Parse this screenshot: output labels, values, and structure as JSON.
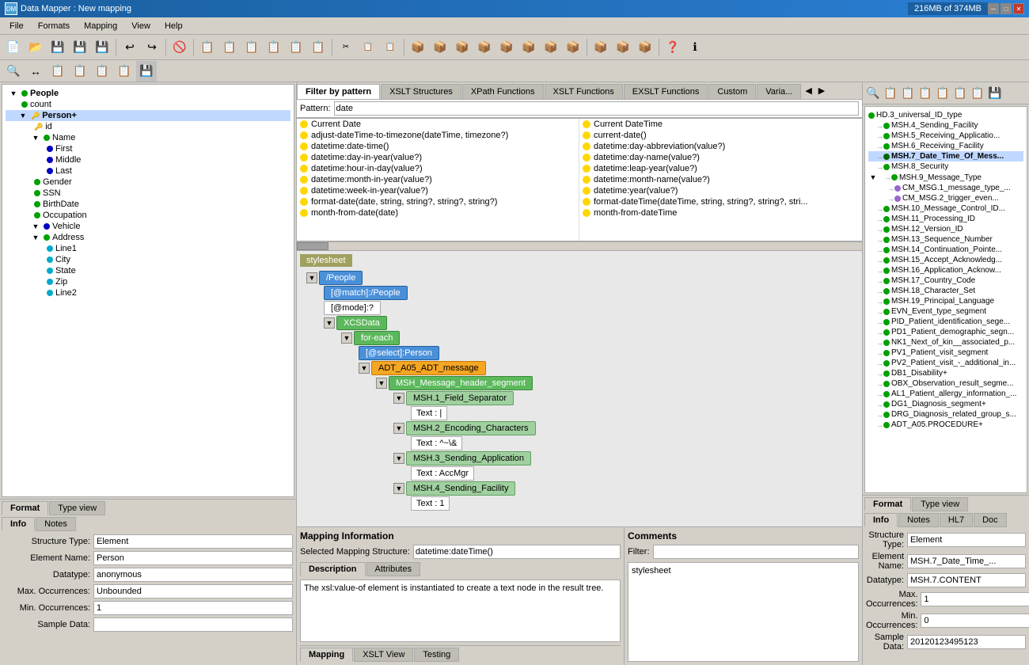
{
  "title_bar": {
    "icon": "DM",
    "title": "Data Mapper : New mapping",
    "memory": "216MB of 374MB"
  },
  "menu": {
    "items": [
      "File",
      "Formats",
      "Mapping",
      "View",
      "Help"
    ]
  },
  "filter_tabs": {
    "tabs": [
      "Filter by pattern",
      "XSLT Structures",
      "XPath Functions",
      "XSLT Functions",
      "EXSLT Functions",
      "Custom",
      "Varia..."
    ],
    "active": 0,
    "pattern_label": "Pattern:",
    "pattern_value": "date"
  },
  "functions": {
    "left": [
      "Current Date",
      "adjust-dateTime-to-timezone(dateTime, timezone?)",
      "datetime:date-time()",
      "datetime:day-in-year(value?)",
      "datetime:hour-in-day(value?)",
      "datetime:month-in-year(value?)",
      "datetime:week-in-year(value?)",
      "format-date(date, string, string?, string?, string?)",
      "month-from-date(date)"
    ],
    "right": [
      "Current DateTime",
      "current-date()",
      "datetime:day-abbreviation(value?)",
      "datetime:day-name(value?)",
      "datetime:leap-year(value?)",
      "datetime:month-name(value?)",
      "datetime:year(value?)",
      "format-dateTime(dateTime, string, string?, string?, stri...",
      "month-from-dateTime"
    ]
  },
  "mapping_tree": {
    "stylesheet_label": "stylesheet",
    "nodes": [
      {
        "indent": 0,
        "toggle": "▼",
        "label": "/People",
        "type": "blue"
      },
      {
        "indent": 1,
        "label": "[@match]:/People",
        "type": "blue"
      },
      {
        "indent": 1,
        "label": "[@mode]:?",
        "type": "white"
      },
      {
        "indent": 1,
        "toggle": "▼",
        "label": "XCSData",
        "type": "green"
      },
      {
        "indent": 2,
        "toggle": "▼",
        "label": "for-each",
        "type": "green"
      },
      {
        "indent": 3,
        "label": "[@select]:Person",
        "type": "blue"
      },
      {
        "indent": 3,
        "toggle": "▼",
        "label": "ADT_A05_ADT_message",
        "type": "orange"
      },
      {
        "indent": 4,
        "toggle": "▼",
        "label": "MSH_Message_header_segment",
        "type": "green"
      },
      {
        "indent": 5,
        "toggle": "▼",
        "label": "MSH.1_Field_Separator",
        "type": "light"
      },
      {
        "indent": 6,
        "label": "Text : |",
        "type": "text"
      },
      {
        "indent": 5,
        "toggle": "▼",
        "label": "MSH.2_Encoding_Characters",
        "type": "light"
      },
      {
        "indent": 6,
        "label": "Text : ^~\\&",
        "type": "text"
      },
      {
        "indent": 5,
        "toggle": "▼",
        "label": "MSH.3_Sending_Application",
        "type": "light"
      },
      {
        "indent": 6,
        "label": "Text : AccMgr",
        "type": "text"
      },
      {
        "indent": 5,
        "toggle": "▼",
        "label": "MSH.4_Sending_Facility",
        "type": "light"
      },
      {
        "indent": 6,
        "label": "Text : 1",
        "type": "text"
      }
    ]
  },
  "mapping_info": {
    "header": "Mapping Information",
    "selected_label": "Selected Mapping Structure:",
    "selected_value": "datetime:dateTime()",
    "desc_tab": "Description",
    "attr_tab": "Attributes",
    "description": "The xsl:value-of element is instantiated to create a text node in the result tree.",
    "bottom_tabs": [
      "Mapping",
      "XSLT View",
      "Testing"
    ]
  },
  "comments": {
    "header": "Comments",
    "filter_label": "Filter:",
    "filter_value": "",
    "content": "stylesheet"
  },
  "left_tree": {
    "root": "People",
    "nodes": [
      {
        "indent": 1,
        "icon": "dot_green",
        "label": "count"
      },
      {
        "indent": 1,
        "icon": "key_expand",
        "label": "Person+",
        "selected": true
      },
      {
        "indent": 2,
        "icon": "key",
        "label": "id"
      },
      {
        "indent": 2,
        "icon": "expand",
        "label": "Name"
      },
      {
        "indent": 3,
        "icon": "dot_blue",
        "label": "First"
      },
      {
        "indent": 3,
        "icon": "dot_blue",
        "label": "Middle"
      },
      {
        "indent": 3,
        "icon": "dot_blue",
        "label": "Last"
      },
      {
        "indent": 2,
        "icon": "dot_green",
        "label": "Gender"
      },
      {
        "indent": 2,
        "icon": "dot_green",
        "label": "SSN"
      },
      {
        "indent": 2,
        "icon": "dot_green",
        "label": "BirthDate"
      },
      {
        "indent": 2,
        "icon": "dot_green",
        "label": "Occupation"
      },
      {
        "indent": 2,
        "icon": "dot_blue_expand",
        "label": "Vehicle"
      },
      {
        "indent": 2,
        "icon": "dot_green_expand",
        "label": "Address"
      },
      {
        "indent": 3,
        "icon": "dot_cyan",
        "label": "Line1"
      },
      {
        "indent": 3,
        "icon": "dot_cyan",
        "label": "City"
      },
      {
        "indent": 3,
        "icon": "dot_cyan",
        "label": "State"
      },
      {
        "indent": 3,
        "icon": "dot_cyan",
        "label": "Zip"
      },
      {
        "indent": 3,
        "icon": "dot_cyan",
        "label": "Line2"
      }
    ]
  },
  "left_bottom": {
    "tabs": [
      "Format",
      "Type view"
    ],
    "info_tab": "Info",
    "notes_tab": "Notes",
    "fields": [
      {
        "label": "Structure Type:",
        "value": "Element"
      },
      {
        "label": "Element Name:",
        "value": "Person"
      },
      {
        "label": "Datatype:",
        "value": "anonymous"
      },
      {
        "label": "Max. Occurrences:",
        "value": "Unbounded"
      },
      {
        "label": "Min. Occurrences:",
        "value": "1"
      },
      {
        "label": "Sample Data:",
        "value": ""
      }
    ]
  },
  "right_tree_nodes": [
    {
      "indent": 0,
      "label": "HD.3_universal_ID_type",
      "icon": "dot_green"
    },
    {
      "indent": 0,
      "label": "MSH.4_Sending_Facility",
      "icon": "dot_green"
    },
    {
      "indent": 0,
      "label": "MSH.5_Receiving_Applicatio...",
      "icon": "dot_green"
    },
    {
      "indent": 0,
      "label": "MSH.6_Receiving_Facility",
      "icon": "dot_green"
    },
    {
      "indent": 0,
      "label": "MSH.7_Date_Time_Of_Mess...",
      "icon": "dot_green_bold"
    },
    {
      "indent": 0,
      "label": "MSH.8_Security",
      "icon": "dot_green"
    },
    {
      "indent": 0,
      "label": "MSH.9_Message_Type",
      "icon": "expand"
    },
    {
      "indent": 1,
      "label": "CM_MSG.1_message_type_...",
      "icon": "dot_green"
    },
    {
      "indent": 1,
      "label": "CM_MSG.2_trigger_even...",
      "icon": "dot_green"
    },
    {
      "indent": 0,
      "label": "MSH.10_Message_Control_ID...",
      "icon": "dot_green"
    },
    {
      "indent": 0,
      "label": "MSH.11_Processing_ID",
      "icon": "dot_green"
    },
    {
      "indent": 0,
      "label": "MSH.12_Version_ID",
      "icon": "dot_green"
    },
    {
      "indent": 0,
      "label": "MSH.13_Sequence_Number",
      "icon": "dot_green"
    },
    {
      "indent": 0,
      "label": "MSH.14_Continuation_Pointe...",
      "icon": "dot_green"
    },
    {
      "indent": 0,
      "label": "MSH.15_Accept_Acknowledg...",
      "icon": "dot_green"
    },
    {
      "indent": 0,
      "label": "MSH.16_Application_Acknow...",
      "icon": "dot_green"
    },
    {
      "indent": 0,
      "label": "MSH.17_Country_Code",
      "icon": "dot_green"
    },
    {
      "indent": 0,
      "label": "MSH.18_Character_Set",
      "icon": "dot_green"
    },
    {
      "indent": 0,
      "label": "MSH.19_Principal_Language",
      "icon": "dot_green"
    },
    {
      "indent": 0,
      "label": "EVN_Event_type_segment",
      "icon": "dot_green"
    },
    {
      "indent": 0,
      "label": "PID_Patient_identification_sege...",
      "icon": "dot_green"
    },
    {
      "indent": 0,
      "label": "PD1_Patient_demographic_segn...",
      "icon": "dot_green"
    },
    {
      "indent": 0,
      "label": "NK1_Next_of_kin__associated_p...",
      "icon": "dot_green"
    },
    {
      "indent": 0,
      "label": "PV1_Patient_visit_segment",
      "icon": "dot_green"
    },
    {
      "indent": 0,
      "label": "PV2_Patient_visit_-_additional_in...",
      "icon": "dot_green"
    },
    {
      "indent": 0,
      "label": "DB1_Disability+",
      "icon": "dot_green"
    },
    {
      "indent": 0,
      "label": "OBX_Observation_result_segme...",
      "icon": "dot_green"
    },
    {
      "indent": 0,
      "label": "AL1_Patient_allergy_information_...",
      "icon": "dot_green"
    },
    {
      "indent": 0,
      "label": "DG1_Diagnosis_segment+",
      "icon": "dot_green"
    },
    {
      "indent": 0,
      "label": "DRG_Diagnosis_related_group_s...",
      "icon": "dot_green"
    },
    {
      "indent": 0,
      "label": "ADT_A05.PROCEDURE+",
      "icon": "dot_green"
    }
  ],
  "right_bottom": {
    "format_tab": "Format",
    "typeview_tab": "Type view",
    "info_tab": "Info",
    "notes_tab": "Notes",
    "hl7_tab": "HL7",
    "doc_tab": "Doc",
    "fields": [
      {
        "label": "Structure Type:",
        "value": "Element"
      },
      {
        "label": "Element Name:",
        "value": "MSH.7_Date_Time_..."
      },
      {
        "label": "Datatype:",
        "value": "MSH.7.CONTENT"
      },
      {
        "label": "Max. Occurrences:",
        "value": "1"
      },
      {
        "label": "Min. Occurrences:",
        "value": "0"
      },
      {
        "label": "Sample Data:",
        "value": "20120123495123"
      }
    ]
  },
  "icons": {
    "toolbar": [
      "📂",
      "💾",
      "💾",
      "💾",
      "✂",
      "🔄",
      "↩",
      "↪",
      "🚫",
      "📋",
      "📄",
      "📑",
      "📋",
      "📋",
      "✂",
      "📋",
      "📋",
      "📋",
      "📦",
      "📦",
      "📦",
      "📦",
      "📦",
      "📦",
      "📦",
      "📦",
      "📦",
      "📦",
      "📦",
      "📦",
      "📦",
      "❓",
      "ℹ"
    ],
    "toolbar2": [
      "🔍",
      "↔",
      "📋",
      "📋",
      "📋",
      "📋",
      "💾"
    ]
  }
}
